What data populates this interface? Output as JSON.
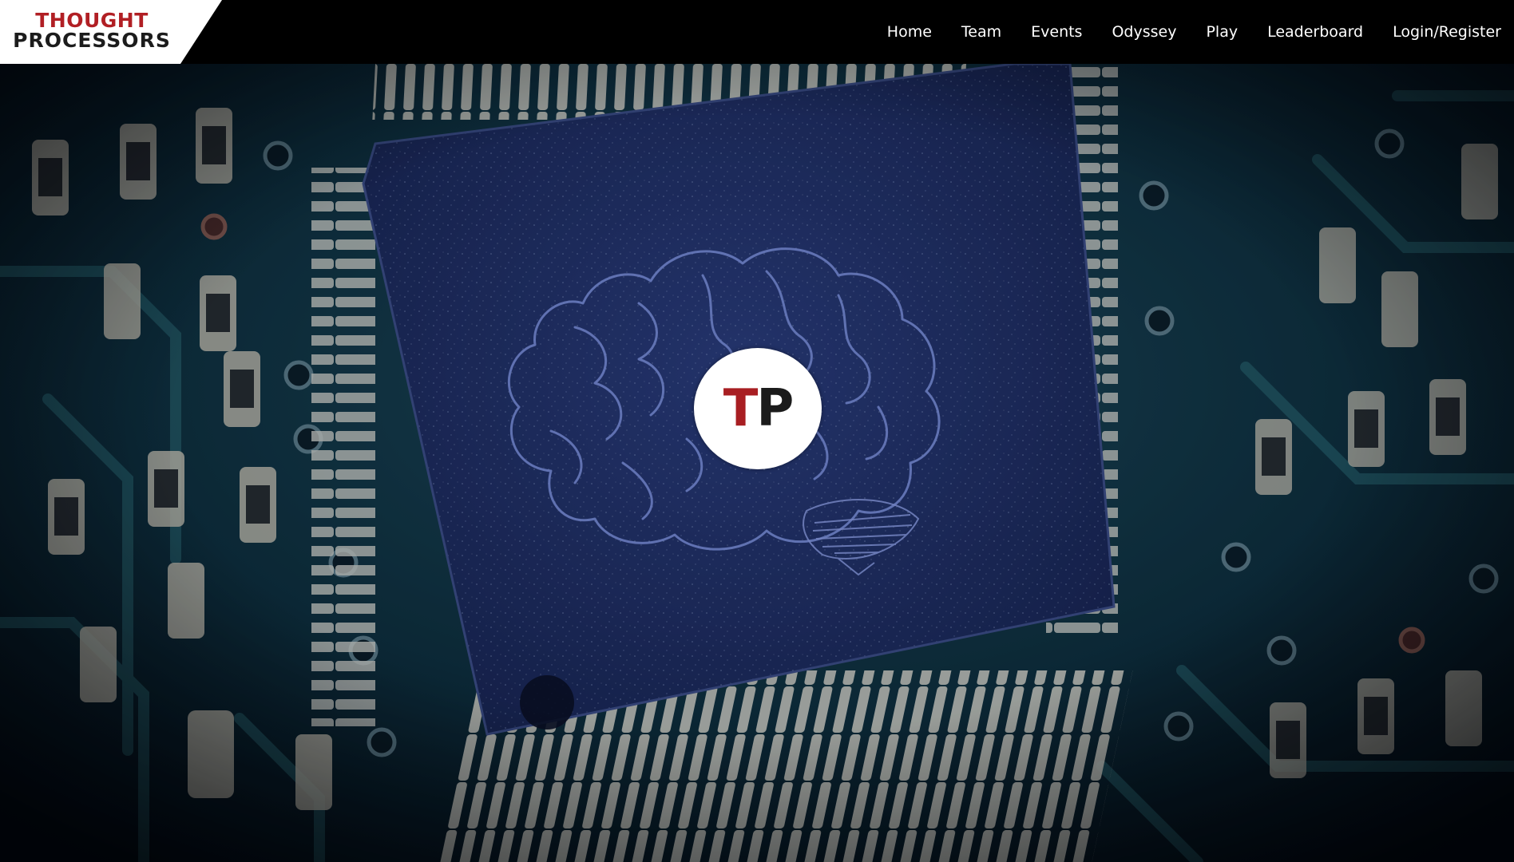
{
  "brand": {
    "line1": "THOUGHT",
    "line2": "PROCESSORS",
    "colors": {
      "red": "#b11f24",
      "dark": "#1c1c1c"
    }
  },
  "nav": {
    "items": [
      {
        "id": "home",
        "label": "Home"
      },
      {
        "id": "team",
        "label": "Team"
      },
      {
        "id": "events",
        "label": "Events"
      },
      {
        "id": "odyssey",
        "label": "Odyssey"
      },
      {
        "id": "play",
        "label": "Play"
      },
      {
        "id": "leaderboard",
        "label": "Leaderboard"
      },
      {
        "id": "login",
        "label": "Login/Register"
      }
    ]
  },
  "hero": {
    "badge": {
      "letter1": "T",
      "letter2": "P"
    },
    "colors": {
      "chip": "#1f2f63",
      "brain_outline": "#7f93e0",
      "board": "#0b2a36"
    }
  }
}
